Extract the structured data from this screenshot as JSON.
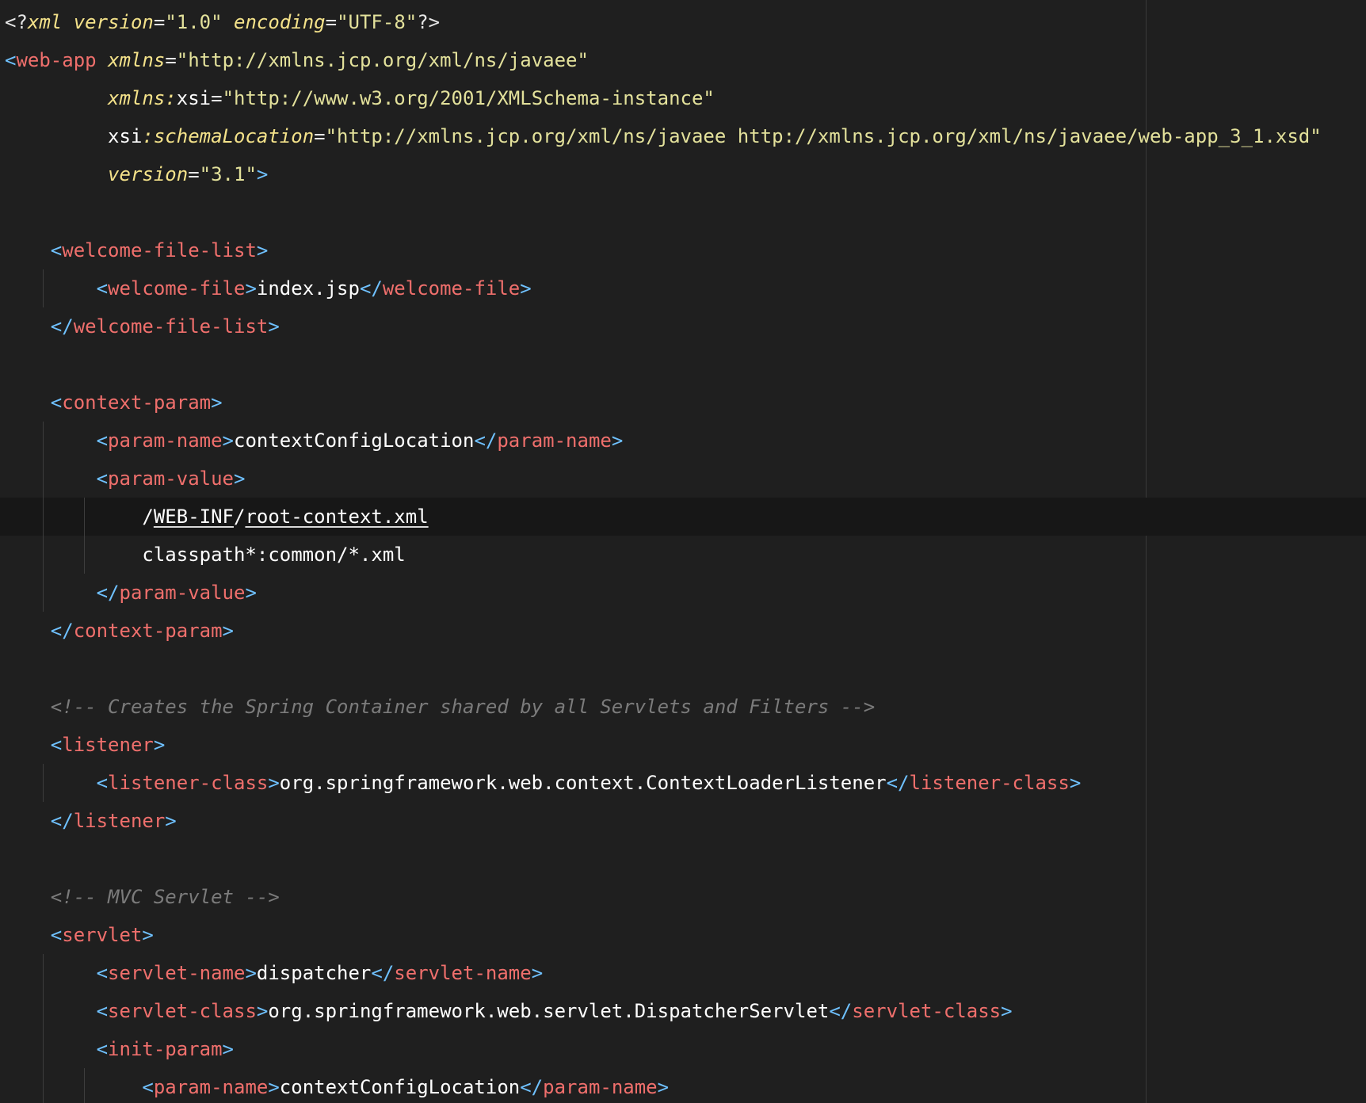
{
  "editor": {
    "file_content": [
      [
        {
          "k": "pun",
          "t": "<?"
        },
        {
          "k": "attr",
          "t": "xml"
        },
        {
          "k": "pun",
          "t": " "
        },
        {
          "k": "attr",
          "t": "version"
        },
        {
          "k": "pun",
          "t": "="
        },
        {
          "k": "str",
          "t": "\"1.0\""
        },
        {
          "k": "pun",
          "t": " "
        },
        {
          "k": "attr",
          "t": "encoding"
        },
        {
          "k": "pun",
          "t": "="
        },
        {
          "k": "str",
          "t": "\"UTF-8\""
        },
        {
          "k": "pun",
          "t": "?>"
        }
      ],
      [
        {
          "k": "br",
          "t": "<"
        },
        {
          "k": "tag",
          "t": "web-app"
        },
        {
          "k": "pun",
          "t": " "
        },
        {
          "k": "attr",
          "t": "xmlns"
        },
        {
          "k": "pun",
          "t": "="
        },
        {
          "k": "str",
          "t": "\"http://xmlns.jcp.org/xml/ns/javaee\""
        }
      ],
      [
        {
          "k": "pun",
          "t": "         "
        },
        {
          "k": "attr",
          "t": "xmlns:"
        },
        {
          "k": "txt",
          "t": "xsi"
        },
        {
          "k": "pun",
          "t": "="
        },
        {
          "k": "str",
          "t": "\"http://www.w3.org/2001/XMLSchema-instance\""
        }
      ],
      [
        {
          "k": "pun",
          "t": "         "
        },
        {
          "k": "txt",
          "t": "xsi"
        },
        {
          "k": "attr",
          "t": ":schemaLocation"
        },
        {
          "k": "pun",
          "t": "="
        },
        {
          "k": "str",
          "t": "\"http://xmlns.jcp.org/xml/ns/javaee http://xmlns.jcp.org/xml/ns/javaee/web-app_3_1.xsd\""
        }
      ],
      [
        {
          "k": "pun",
          "t": "         "
        },
        {
          "k": "attr",
          "t": "version"
        },
        {
          "k": "pun",
          "t": "="
        },
        {
          "k": "str",
          "t": "\"3.1\""
        },
        {
          "k": "br",
          "t": ">"
        }
      ],
      [],
      [
        {
          "k": "pun",
          "t": "    "
        },
        {
          "k": "br",
          "t": "<"
        },
        {
          "k": "tag",
          "t": "welcome-file-list"
        },
        {
          "k": "br",
          "t": ">"
        }
      ],
      [
        {
          "k": "pun",
          "t": "        "
        },
        {
          "k": "br",
          "t": "<"
        },
        {
          "k": "tag",
          "t": "welcome-file"
        },
        {
          "k": "br",
          "t": ">"
        },
        {
          "k": "txt",
          "t": "index.jsp"
        },
        {
          "k": "br",
          "t": "</"
        },
        {
          "k": "tag",
          "t": "welcome-file"
        },
        {
          "k": "br",
          "t": ">"
        }
      ],
      [
        {
          "k": "pun",
          "t": "    "
        },
        {
          "k": "br",
          "t": "</"
        },
        {
          "k": "tag",
          "t": "welcome-file-list"
        },
        {
          "k": "br",
          "t": ">"
        }
      ],
      [],
      [
        {
          "k": "pun",
          "t": "    "
        },
        {
          "k": "br",
          "t": "<"
        },
        {
          "k": "tag",
          "t": "context-param"
        },
        {
          "k": "br",
          "t": ">"
        }
      ],
      [
        {
          "k": "pun",
          "t": "        "
        },
        {
          "k": "br",
          "t": "<"
        },
        {
          "k": "tag",
          "t": "param-name"
        },
        {
          "k": "br",
          "t": ">"
        },
        {
          "k": "txt",
          "t": "contextConfigLocation"
        },
        {
          "k": "br",
          "t": "</"
        },
        {
          "k": "tag",
          "t": "param-name"
        },
        {
          "k": "br",
          "t": ">"
        }
      ],
      [
        {
          "k": "pun",
          "t": "        "
        },
        {
          "k": "br",
          "t": "<"
        },
        {
          "k": "tag",
          "t": "param-value"
        },
        {
          "k": "br",
          "t": ">"
        }
      ],
      [
        {
          "k": "pun",
          "t": "            "
        },
        {
          "k": "txt",
          "t": "/"
        },
        {
          "k": "txt ul",
          "t": "WEB-INF"
        },
        {
          "k": "txt",
          "t": "/"
        },
        {
          "k": "txt ul",
          "t": "root-context.xml"
        }
      ],
      [
        {
          "k": "pun",
          "t": "            "
        },
        {
          "k": "txt",
          "t": "classpath*:common/*.xml"
        }
      ],
      [
        {
          "k": "pun",
          "t": "        "
        },
        {
          "k": "br",
          "t": "</"
        },
        {
          "k": "tag",
          "t": "param-value"
        },
        {
          "k": "br",
          "t": ">"
        }
      ],
      [
        {
          "k": "pun",
          "t": "    "
        },
        {
          "k": "br",
          "t": "</"
        },
        {
          "k": "tag",
          "t": "context-param"
        },
        {
          "k": "br",
          "t": ">"
        }
      ],
      [],
      [
        {
          "k": "pun",
          "t": "    "
        },
        {
          "k": "cmt",
          "t": "<!-- Creates the Spring Container shared by all Servlets and Filters -->"
        }
      ],
      [
        {
          "k": "pun",
          "t": "    "
        },
        {
          "k": "br",
          "t": "<"
        },
        {
          "k": "tag",
          "t": "listener"
        },
        {
          "k": "br",
          "t": ">"
        }
      ],
      [
        {
          "k": "pun",
          "t": "        "
        },
        {
          "k": "br",
          "t": "<"
        },
        {
          "k": "tag",
          "t": "listener-class"
        },
        {
          "k": "br",
          "t": ">"
        },
        {
          "k": "txt",
          "t": "org.springframework.web.context.ContextLoaderListener"
        },
        {
          "k": "br",
          "t": "</"
        },
        {
          "k": "tag",
          "t": "listener-class"
        },
        {
          "k": "br",
          "t": ">"
        }
      ],
      [
        {
          "k": "pun",
          "t": "    "
        },
        {
          "k": "br",
          "t": "</"
        },
        {
          "k": "tag",
          "t": "listener"
        },
        {
          "k": "br",
          "t": ">"
        }
      ],
      [],
      [
        {
          "k": "pun",
          "t": "    "
        },
        {
          "k": "cmt",
          "t": "<!-- MVC Servlet -->"
        }
      ],
      [
        {
          "k": "pun",
          "t": "    "
        },
        {
          "k": "br",
          "t": "<"
        },
        {
          "k": "tag",
          "t": "servlet"
        },
        {
          "k": "br",
          "t": ">"
        }
      ],
      [
        {
          "k": "pun",
          "t": "        "
        },
        {
          "k": "br",
          "t": "<"
        },
        {
          "k": "tag",
          "t": "servlet-name"
        },
        {
          "k": "br",
          "t": ">"
        },
        {
          "k": "txt",
          "t": "dispatcher"
        },
        {
          "k": "br",
          "t": "</"
        },
        {
          "k": "tag",
          "t": "servlet-name"
        },
        {
          "k": "br",
          "t": ">"
        }
      ],
      [
        {
          "k": "pun",
          "t": "        "
        },
        {
          "k": "br",
          "t": "<"
        },
        {
          "k": "tag",
          "t": "servlet-class"
        },
        {
          "k": "br",
          "t": ">"
        },
        {
          "k": "txt",
          "t": "org.springframework.web.servlet.DispatcherServlet"
        },
        {
          "k": "br",
          "t": "</"
        },
        {
          "k": "tag",
          "t": "servlet-class"
        },
        {
          "k": "br",
          "t": ">"
        }
      ],
      [
        {
          "k": "pun",
          "t": "        "
        },
        {
          "k": "br",
          "t": "<"
        },
        {
          "k": "tag",
          "t": "init-param"
        },
        {
          "k": "br",
          "t": ">"
        }
      ],
      [
        {
          "k": "pun",
          "t": "            "
        },
        {
          "k": "br",
          "t": "<"
        },
        {
          "k": "tag",
          "t": "param-name"
        },
        {
          "k": "br",
          "t": ">"
        },
        {
          "k": "txt",
          "t": "contextConfigLocation"
        },
        {
          "k": "br",
          "t": "</"
        },
        {
          "k": "tag",
          "t": "param-name"
        },
        {
          "k": "br",
          "t": ">"
        }
      ]
    ],
    "current_line": 14,
    "colors": {
      "background": "#1f1f1f",
      "current_line": "#171717",
      "tag": "#ef6f6c",
      "bracket": "#6fc1ff",
      "attribute": "#f4e28a",
      "string": "#e3e19b",
      "comment": "#7b7b7b",
      "text": "#ffffff"
    }
  }
}
